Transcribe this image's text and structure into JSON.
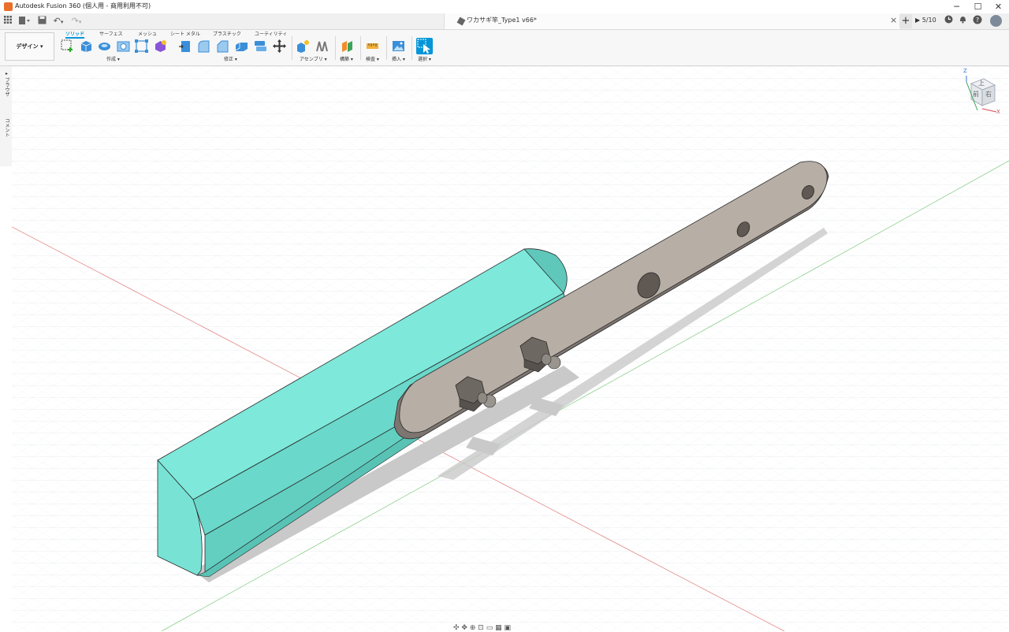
{
  "title_bar": {
    "app_title": "Autodesk Fusion 360 (個人用 - 商用利用不可)",
    "minimize": "─",
    "maximize": "☐",
    "close": "✕"
  },
  "tab_bar": {
    "document_title": "ワカサギ竿_Type1 v66*",
    "close_tab": "×",
    "new_tab": "+",
    "jobs_status": "5/10"
  },
  "toolbar": {
    "workspace": "デザイン ▾",
    "tabs": [
      "ソリッド",
      "サーフェス",
      "メッシュ",
      "シート メタル",
      "プラスチック",
      "ユーティリティ"
    ],
    "groups": {
      "create": "作成 ▾",
      "modify": "修正 ▾",
      "assemble": "アセンブリ ▾",
      "construct": "構築 ▾",
      "inspect": "検査 ▾",
      "insert": "挿入 ▾",
      "select": "選択 ▾"
    }
  },
  "browser": {
    "panel": "ブラウザ",
    "comments": "コメント"
  },
  "viewcube": {
    "top": "上",
    "front": "前",
    "right": "右",
    "axis_z": "Z",
    "axis_x": "X"
  },
  "colors": {
    "accent": "#0696d7",
    "teal_body": "#70ddd0",
    "link_plate": "#b8afa6",
    "nut": "#7a7570"
  },
  "icons": [
    "grid-icon",
    "file-icon",
    "save-icon",
    "undo-icon",
    "redo-icon",
    "jobs-icon",
    "clock-icon",
    "bell-icon",
    "help-icon"
  ]
}
